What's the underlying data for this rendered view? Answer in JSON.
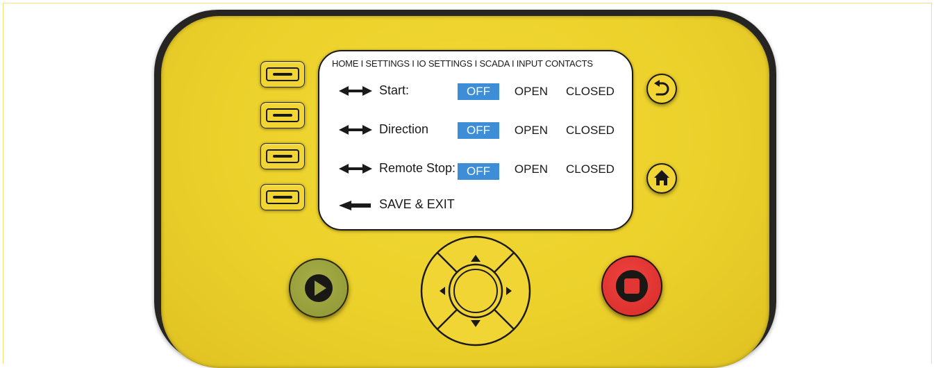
{
  "screen": {
    "breadcrumb": "HOME I SETTINGS I IO SETTINGS I SCADA I INPUT CONTACTS",
    "rows": [
      {
        "label": "Start:",
        "options": [
          "OFF",
          "OPEN",
          "CLOSED"
        ],
        "selected": "OFF"
      },
      {
        "label": "Direction",
        "options": [
          "OFF",
          "OPEN",
          "CLOSED"
        ],
        "selected": "OFF"
      },
      {
        "label": "Remote Stop:",
        "options": [
          "OFF",
          "OPEN",
          "CLOSED"
        ],
        "selected": "OFF"
      }
    ],
    "save_label": "SAVE & EXIT",
    "selection_color": "#3d8ed6"
  },
  "icons": {
    "row_arrow": "left-right-arrow-icon",
    "save_arrow": "left-arrow-icon",
    "back": "undo-arrow-icon",
    "home": "home-icon",
    "play": "play-icon",
    "stop": "stop-icon",
    "dpad": [
      "up-arrow-icon",
      "down-arrow-icon",
      "left-arrow-icon",
      "right-arrow-icon"
    ]
  },
  "colors": {
    "housing": "#ecd12b",
    "bezel": "#272524",
    "play_button": "#9aa13e",
    "stop_button": "#e23634"
  }
}
